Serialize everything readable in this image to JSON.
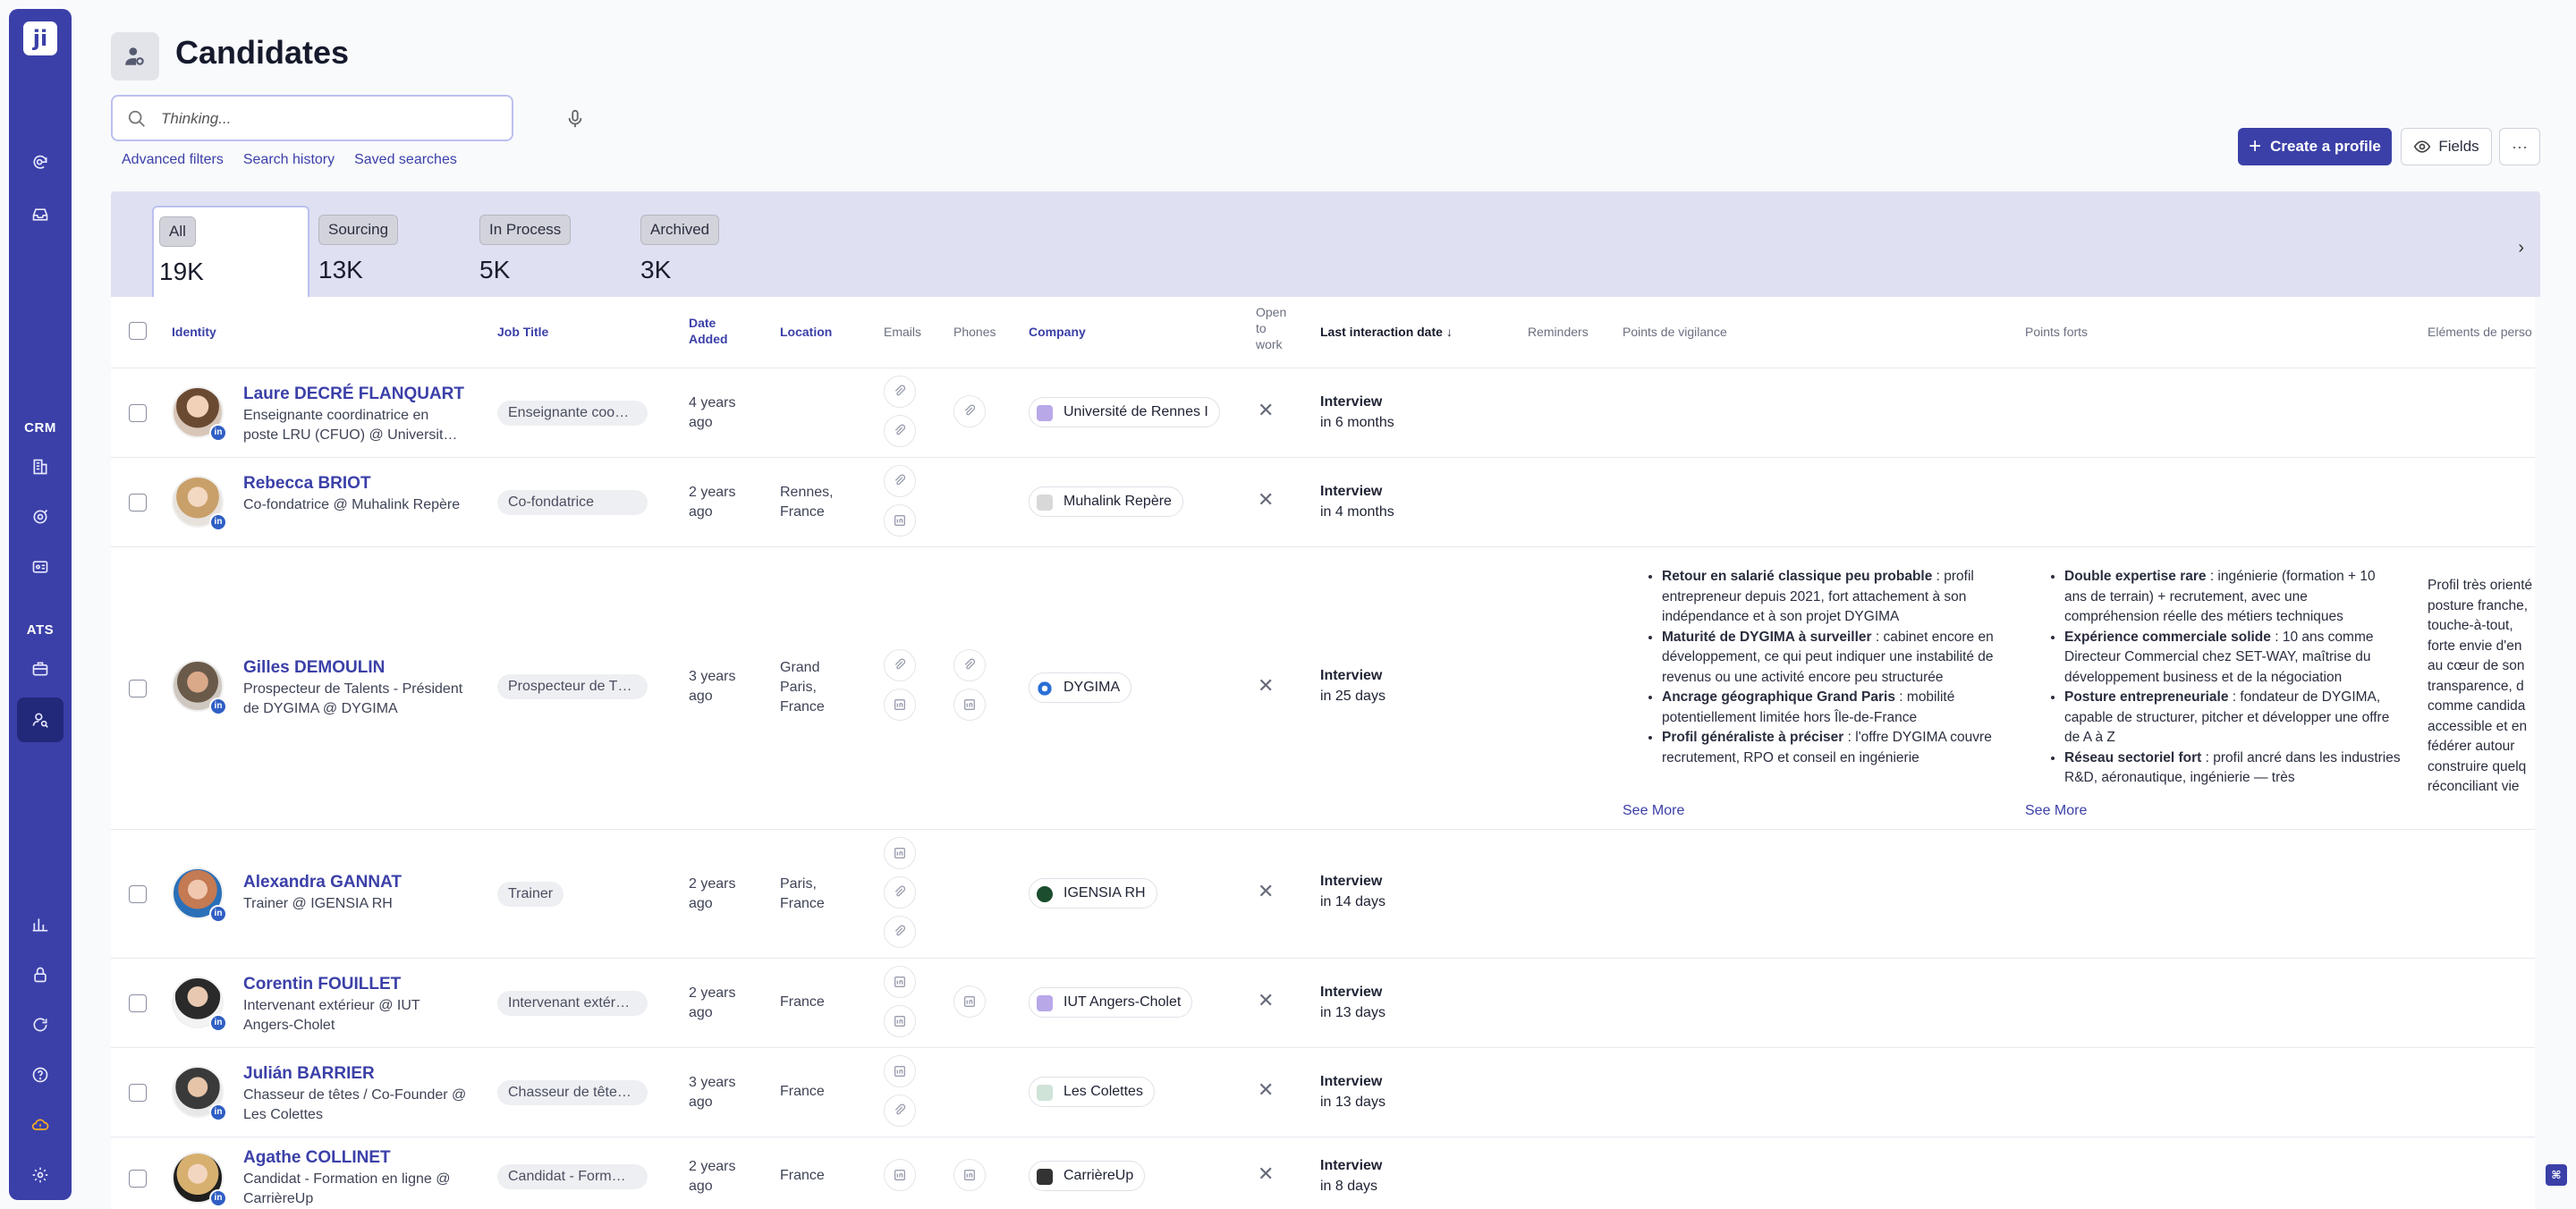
{
  "sidebar": {
    "logo": "ji",
    "crm_label": "CRM",
    "ats_label": "ATS"
  },
  "header": {
    "title": "Candidates",
    "search_placeholder": "Thinking...",
    "links": [
      "Advanced filters",
      "Search history",
      "Saved searches"
    ],
    "create_label": "Create a profile",
    "fields_label": "Fields",
    "more_label": "···"
  },
  "tabs": [
    {
      "label": "All",
      "count": "19K"
    },
    {
      "label": "Sourcing",
      "count": "13K"
    },
    {
      "label": "In Process",
      "count": "5K"
    },
    {
      "label": "Archived",
      "count": "3K"
    }
  ],
  "columns": {
    "identity": "Identity",
    "job_title": "Job Title",
    "date_added": "Date Added",
    "location": "Location",
    "emails": "Emails",
    "phones": "Phones",
    "company": "Company",
    "open_to_work": "Open to work",
    "last_interaction": "Last interaction date",
    "reminders": "Reminders",
    "vigilance": "Points de vigilance",
    "forts": "Points forts",
    "elements": "Eléments de perso"
  },
  "rows": [
    {
      "name": "Laure DECRÉ FLANQUART",
      "headline": "Enseignante coordinatrice en poste LRU (CFUO) @ Universit…",
      "job": "Enseignante coo…",
      "date": "4 years ago",
      "location": "",
      "company": "Université de Rennes I",
      "interaction_type": "Interview",
      "interaction_when": "in 6 months"
    },
    {
      "name": "Rebecca BRIOT",
      "headline": "Co-fondatrice @ Muhalink Repère",
      "job": "Co-fondatrice",
      "date": "2 years ago",
      "location": "Rennes, France",
      "company": "Muhalink Repère",
      "interaction_type": "Interview",
      "interaction_when": "in 4 months"
    },
    {
      "name": "Gilles DEMOULIN",
      "headline": "Prospecteur de Talents - Président de DYGIMA @ DYGIMA",
      "job": "Prospecteur de T…",
      "date": "3 years ago",
      "location": "Grand Paris, France",
      "company": "DYGIMA",
      "interaction_type": "Interview",
      "interaction_when": "in 25 days",
      "vigilance": [
        {
          "title": "Retour en salarié classique peu probable",
          "text": " : profil entrepreneur depuis 2021, fort attachement à son indépendance et à son projet DYGIMA"
        },
        {
          "title": "Maturité de DYGIMA à surveiller",
          "text": " : cabinet encore en développement, ce qui peut indiquer une instabilité de revenus ou une activité encore peu structurée"
        },
        {
          "title": "Ancrage géographique Grand Paris",
          "text": " : mobilité potentiellement limitée hors Île-de-France"
        },
        {
          "title": "Profil généraliste à préciser",
          "text": " : l'offre DYGIMA couvre recrutement, RPO et conseil en ingénierie"
        }
      ],
      "forts": [
        {
          "title": "Double expertise rare",
          "text": " : ingénierie (formation + 10 ans de terrain) + recrutement, avec une compréhension réelle des métiers techniques"
        },
        {
          "title": "Expérience commerciale solide",
          "text": " : 10 ans comme Directeur Commercial chez SET-WAY, maîtrise du développement business et de la négociation"
        },
        {
          "title": "Posture entrepreneuriale",
          "text": " : fondateur de DYGIMA, capable de structurer, pitcher et développer une offre de A à Z"
        },
        {
          "title": "Réseau sectoriel fort",
          "text": " : profil ancré dans les industries R&D, aéronautique, ingénierie — très"
        }
      ],
      "see_more": "See More",
      "elements": "Profil très orienté posture franche, touche-à-tout, forte envie d'en au cœur de son transparence, d comme candida accessible et en fédérer autour construire quelq réconciliant vie"
    },
    {
      "name": "Alexandra GANNAT",
      "headline": "Trainer @ IGENSIA RH",
      "job": "Trainer",
      "date": "2 years ago",
      "location": "Paris, France",
      "company": "IGENSIA RH",
      "interaction_type": "Interview",
      "interaction_when": "in 14 days"
    },
    {
      "name": "Corentin FOUILLET",
      "headline": "Intervenant extérieur @ IUT Angers-Cholet",
      "job": "Intervenant extér…",
      "date": "2 years ago",
      "location": "France",
      "company": "IUT Angers-Cholet",
      "interaction_type": "Interview",
      "interaction_when": "in 13 days"
    },
    {
      "name": "Julián BARRIER",
      "headline": "Chasseur de têtes / Co-Founder @ Les Colettes",
      "job": "Chasseur de tête…",
      "date": "3 years ago",
      "location": "France",
      "company": "Les Colettes",
      "interaction_type": "Interview",
      "interaction_when": "in 13 days"
    },
    {
      "name": "Agathe COLLINET",
      "headline": "Candidat - Formation en ligne @ CarrièreUp",
      "job": "Candidat - Form…",
      "date": "2 years ago",
      "location": "France",
      "company": "CarrièreUp",
      "interaction_type": "Interview",
      "interaction_when": "in 8 days"
    }
  ],
  "badges": {
    "linkedin": "in"
  },
  "colors": {
    "accent": "#3b40a8",
    "tabs_bg": "#dfe1f2"
  }
}
